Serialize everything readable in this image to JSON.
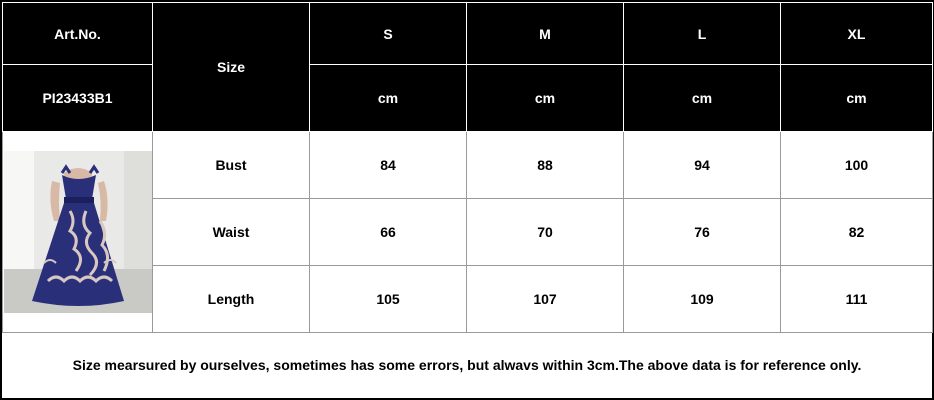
{
  "header": {
    "art_no_label": "Art.No.",
    "art_no_value": "PI23433B1",
    "size_label": "Size",
    "sizes": [
      "S",
      "M",
      "L",
      "XL"
    ],
    "units": [
      "cm",
      "cm",
      "cm",
      "cm"
    ]
  },
  "rows": [
    {
      "label": "Bust",
      "values": [
        "84",
        "88",
        "94",
        "100"
      ]
    },
    {
      "label": "Waist",
      "values": [
        "66",
        "70",
        "76",
        "82"
      ]
    },
    {
      "label": "Length",
      "values": [
        "105",
        "107",
        "109",
        "111"
      ]
    }
  ],
  "note": "Size mearsured by ourselves, sometimes has some errors, but alwavs within 3cm.The above data is for reference only.",
  "colors": {
    "header_bg": "#000000",
    "header_text": "#ffffff",
    "dress": "#2a2f7a",
    "lining": "#d9c8c1"
  }
}
